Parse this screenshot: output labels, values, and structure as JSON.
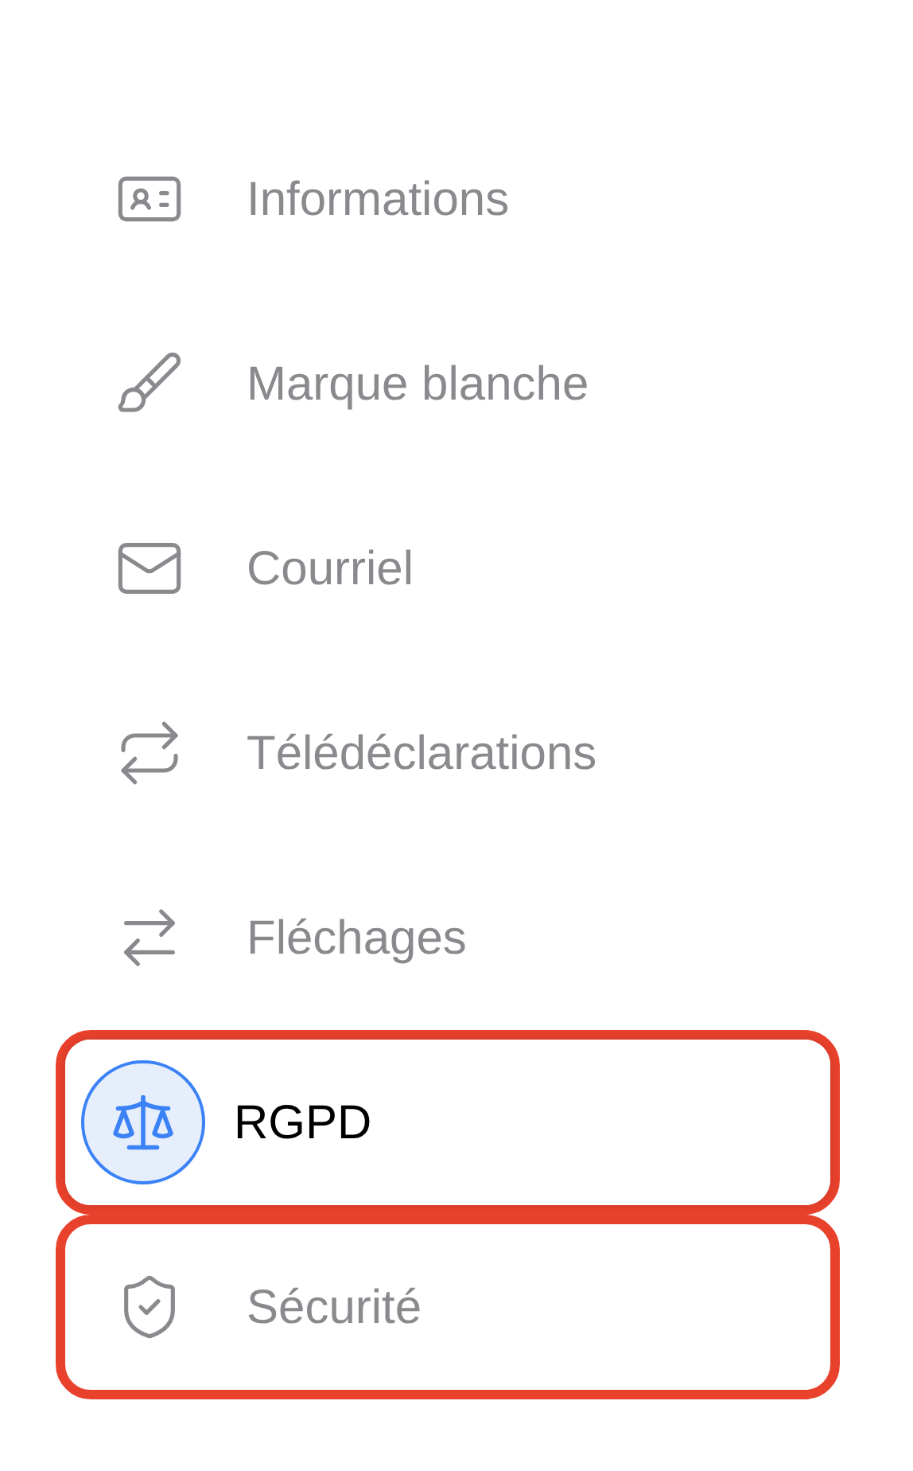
{
  "menu": {
    "items": [
      {
        "label": "Informations",
        "selected": false,
        "highlighted": false
      },
      {
        "label": "Marque blanche",
        "selected": false,
        "highlighted": false
      },
      {
        "label": "Courriel",
        "selected": false,
        "highlighted": false
      },
      {
        "label": "Télédéclarations",
        "selected": false,
        "highlighted": false
      },
      {
        "label": "Fléchages",
        "selected": false,
        "highlighted": false
      },
      {
        "label": "RGPD",
        "selected": true,
        "highlighted": true
      },
      {
        "label": "Sécurité",
        "selected": false,
        "highlighted": true
      }
    ]
  }
}
